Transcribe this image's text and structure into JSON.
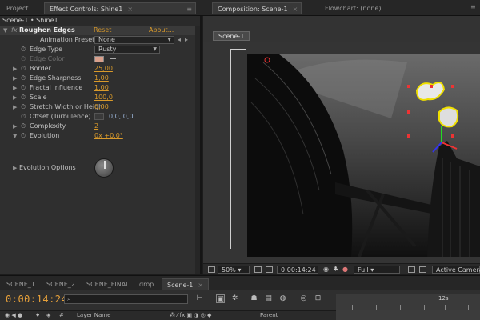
{
  "top_tabs": {
    "project": "Project",
    "effect_controls": "Effect Controls: Shine1",
    "composition": "Composition: Scene-1",
    "flowchart": "Flowchart: (none)"
  },
  "effect_panel": {
    "breadcrumb": "Scene-1 • Shine1",
    "fx_name": "Roughen Edges",
    "reset": "Reset",
    "about": "About...",
    "animation_presets_label": "Animation Presets:",
    "animation_presets_value": "None",
    "params": {
      "edge_type": {
        "label": "Edge Type",
        "value": "Rusty"
      },
      "edge_color": {
        "label": "Edge Color"
      },
      "border": {
        "label": "Border",
        "value": "25,00"
      },
      "edge_sharpness": {
        "label": "Edge Sharpness",
        "value": "1,00"
      },
      "fractal_influence": {
        "label": "Fractal Influence",
        "value": "1,00"
      },
      "scale": {
        "label": "Scale",
        "value": "100,0"
      },
      "stretch": {
        "label": "Stretch Width or Heigh",
        "value": "0,00"
      },
      "offset": {
        "label": "Offset (Turbulence)",
        "value": "0,0, 0,0"
      },
      "complexity": {
        "label": "Complexity",
        "value": "2"
      },
      "evolution": {
        "label": "Evolution",
        "value": "0x +0,0°"
      },
      "evolution_options": {
        "label": "Evolution Options"
      }
    }
  },
  "composition": {
    "scene_button": "Scene-1",
    "zoom": "50%",
    "timecode": "0:00:14:24",
    "resolution": "Full",
    "camera": "Active Camera"
  },
  "timeline": {
    "tabs": [
      "SCENE_1",
      "SCENE_2",
      "SCENE_FINAL",
      "drop",
      "Scene-1"
    ],
    "timecode": "0:00:14:24",
    "ruler_label": "12s",
    "col_number": "#",
    "col_layer_name": "Layer Name",
    "col_parent": "Parent"
  },
  "colors": {
    "accent": "#d99a2b",
    "panel": "#2f2f2f",
    "background": "#1c1c1c"
  }
}
